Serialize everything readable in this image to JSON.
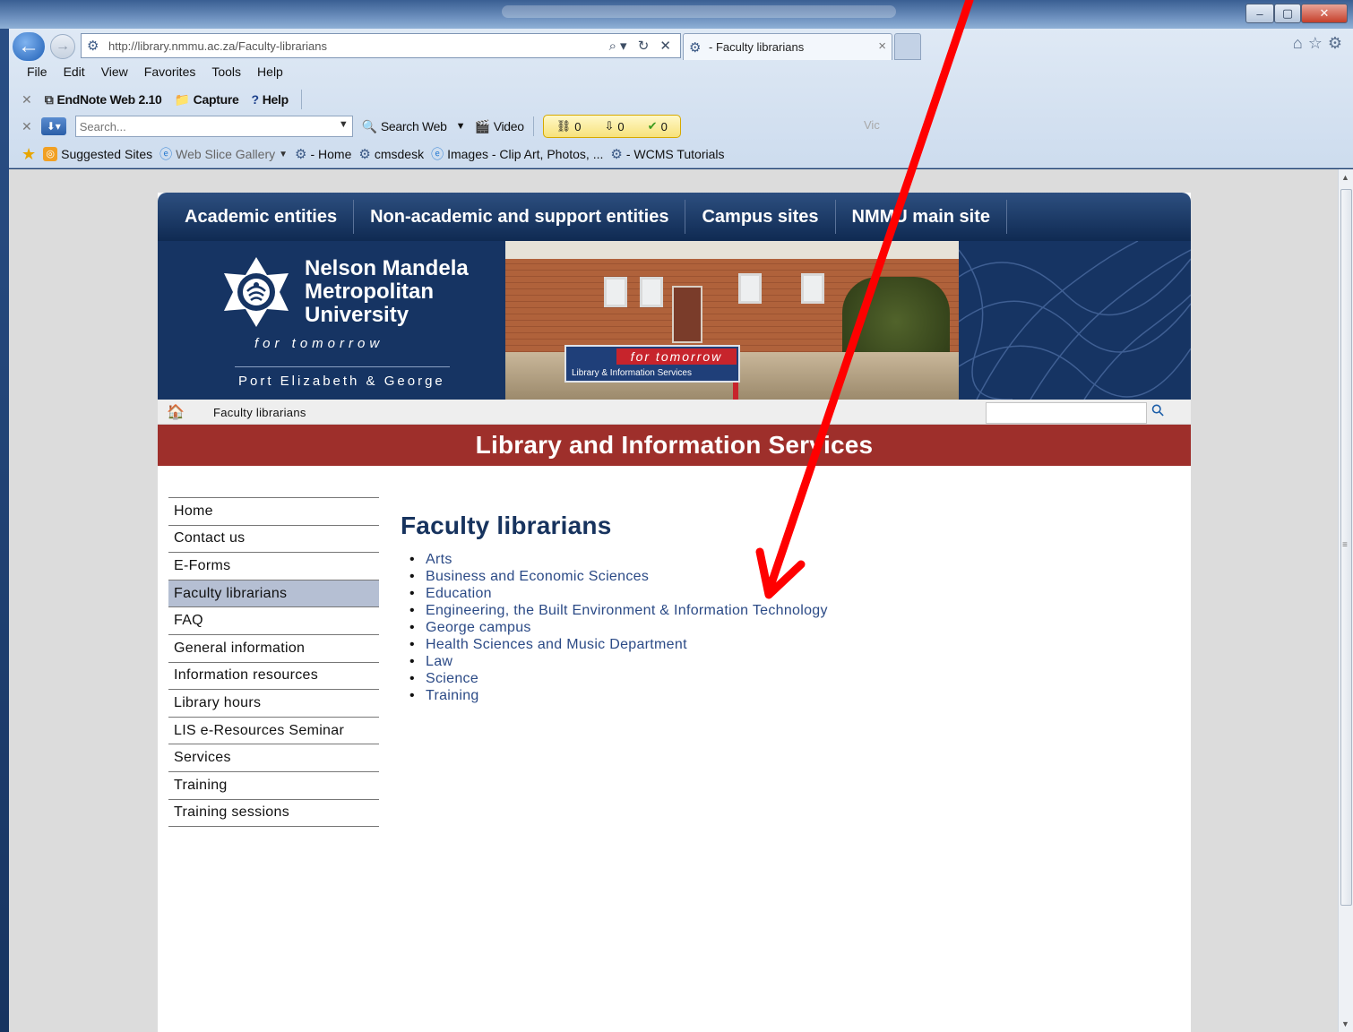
{
  "browser": {
    "address_url": "http://library.nmmu.ac.za/Faculty-librarians",
    "address_controls": "⌕▾ ↻ ✕",
    "tab_title": "- Faculty librarians",
    "window_controls": {
      "minimize": "–",
      "maximize": "▢",
      "close": "✕"
    }
  },
  "menubar": {
    "items": [
      {
        "label": "File"
      },
      {
        "label": "Edit"
      },
      {
        "label": "View"
      },
      {
        "label": "Favorites"
      },
      {
        "label": "Tools"
      },
      {
        "label": "Help"
      }
    ]
  },
  "toolbar1": {
    "endnote_label": "EndNote Web 2.10",
    "capture_label": "Capture",
    "help_label": "Help"
  },
  "toolbar2": {
    "search_placeholder": "Search...",
    "search_web_label": "Search Web",
    "video_label": "Video",
    "counters": [
      "0",
      "0",
      "0"
    ],
    "faded_text": "Vic"
  },
  "favorites": {
    "items": [
      {
        "label": "Suggested Sites"
      },
      {
        "label": "Web Slice Gallery"
      },
      {
        "label": "- Home"
      },
      {
        "label": "cmsdesk"
      },
      {
        "label": "Images - Clip Art, Photos, ..."
      },
      {
        "label": "- WCMS Tutorials"
      }
    ]
  },
  "site": {
    "top_nav": [
      {
        "label": "Academic entities"
      },
      {
        "label": "Non-academic and support entities"
      },
      {
        "label": "Campus sites"
      },
      {
        "label": "NMMU main site"
      }
    ],
    "university_name_line1": "Nelson Mandela",
    "university_name_line2": "Metropolitan",
    "university_name_line3": "University",
    "tagline": "for tomorrow",
    "campuses": "Port Elizabeth & George",
    "sign_tagline": "for tomorrow",
    "sign_subtitle": "Library & Information Services",
    "breadcrumb": "Faculty librarians",
    "section_title": "Library and Information Services",
    "side_nav": [
      {
        "label": "Home",
        "active": false
      },
      {
        "label": "Contact us",
        "active": false
      },
      {
        "label": "E-Forms",
        "active": false
      },
      {
        "label": "Faculty librarians",
        "active": true
      },
      {
        "label": "FAQ",
        "active": false
      },
      {
        "label": "General information",
        "active": false
      },
      {
        "label": "Information resources",
        "active": false
      },
      {
        "label": "Library hours",
        "active": false
      },
      {
        "label": "LIS e-Resources Seminar",
        "active": false
      },
      {
        "label": "Services",
        "active": false
      },
      {
        "label": "Training",
        "active": false
      },
      {
        "label": "Training sessions",
        "active": false
      }
    ],
    "page_heading": "Faculty librarians",
    "faculty_links": [
      {
        "label": "Arts"
      },
      {
        "label": "Business and Economic Sciences"
      },
      {
        "label": "Education"
      },
      {
        "label": "Engineering, the Built Environment & Information Technology"
      },
      {
        "label": "George campus"
      },
      {
        "label": "Health Sciences and Music Department"
      },
      {
        "label": "Law"
      },
      {
        "label": "Science"
      },
      {
        "label": "Training"
      }
    ]
  },
  "colors": {
    "nav_dark": "#163463",
    "section_bar": "#9e2f2b",
    "link": "#2b4a86",
    "active_nav": "#b5bfd3",
    "annotation_arrow": "#ff0000"
  }
}
